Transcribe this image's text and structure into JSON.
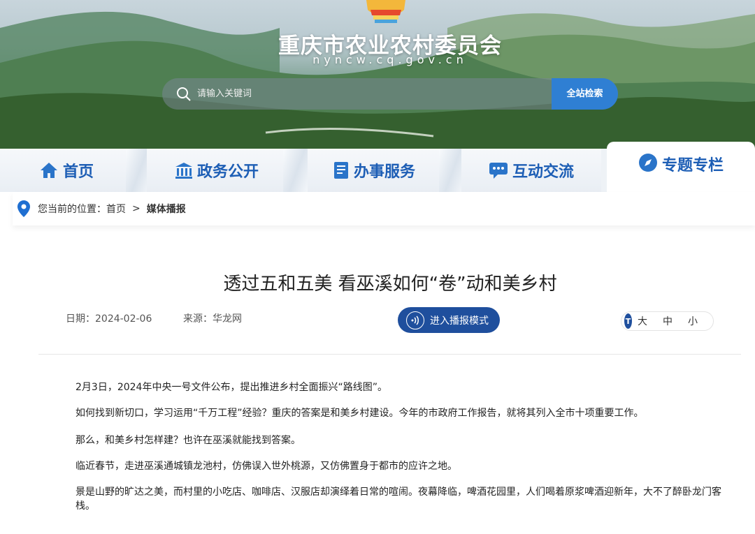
{
  "header": {
    "site_title": "重庆市农业农村委员会",
    "site_url": "nyncw.cq.gov.cn",
    "search_placeholder": "请输入关键词",
    "search_button": "全站检索"
  },
  "nav": {
    "items": [
      {
        "label": "首页",
        "icon": "home-icon"
      },
      {
        "label": "政务公开",
        "icon": "building-icon"
      },
      {
        "label": "办事服务",
        "icon": "document-icon"
      },
      {
        "label": "互动交流",
        "icon": "chat-icon"
      },
      {
        "label": "专题专栏",
        "icon": "compass-icon"
      }
    ]
  },
  "breadcrumb": {
    "prefix": "您当前的位置：",
    "home": "首页",
    "separator": ">",
    "current": "媒体播报"
  },
  "article": {
    "title": "透过五和五美 看巫溪如何“卷”动和美乡村",
    "date": "日期：2024-02-06",
    "source": "来源：华龙网",
    "play_button": "进入播报模式",
    "font_sizes": [
      "大",
      "中",
      "小"
    ],
    "font_icon_text": "T",
    "paragraphs": [
      "2月3日，2024年中央一号文件公布，提出推进乡村全面振兴“路线图”。",
      "如何找到新切口，学习运用“千万工程”经验？重庆的答案是和美乡村建设。今年的市政府工作报告，就将其列入全市十项重要工作。",
      "那么，和美乡村怎样建？也许在巫溪就能找到答案。",
      "临近春节，走进巫溪通城镇龙池村，仿佛误入世外桃源，又仿佛置身于都市的应许之地。",
      "景是山野的旷达之美，而村里的小吃店、咖啡店、汉服店却演绎着日常的喧闹。夜幕降临，啤酒花园里，人们喝着原浆啤酒迎新年，大不了醉卧龙门客栈。"
    ]
  },
  "colors": {
    "brand_blue": "#1f4f9d",
    "nav_blue": "#1d5eb5",
    "search_blue": "#2f7fd3"
  }
}
